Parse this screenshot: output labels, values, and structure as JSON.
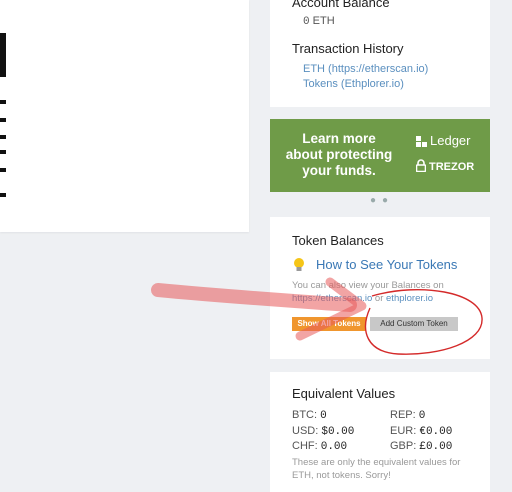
{
  "account": {
    "balance_title": "Account Balance",
    "balance_value": "0",
    "balance_unit": "ETH",
    "history_title": "Transaction History",
    "eth_link": "ETH (https://etherscan.io)",
    "tokens_link": "Tokens (Ethplorer.io)"
  },
  "banner": {
    "line1": "Learn more",
    "line2": "about protecting",
    "line3": "your funds.",
    "ledger": "Ledger",
    "trezor": "TREZOR"
  },
  "tokens": {
    "title": "Token Balances",
    "howto": "How to See Your Tokens",
    "note_prefix": "You can also view your Balances on",
    "etherscan": "https://etherscan.io",
    "or": "or",
    "ethplorer": "ethplorer.io",
    "show_all": "Show All Tokens",
    "add_custom": "Add Custom Token"
  },
  "equivalent": {
    "title": "Equivalent Values",
    "btc_label": "BTC:",
    "btc_value": "0",
    "rep_label": "REP:",
    "rep_value": "0",
    "usd_label": "USD:",
    "usd_value": "$0.00",
    "eur_label": "EUR:",
    "eur_value": "€0.00",
    "chf_label": "CHF:",
    "chf_value": "0.00",
    "gbp_label": "GBP:",
    "gbp_value": "£0.00",
    "note": "These are only the equivalent values for ETH, not tokens. Sorry!"
  },
  "annotation_color": "#e85a5a"
}
